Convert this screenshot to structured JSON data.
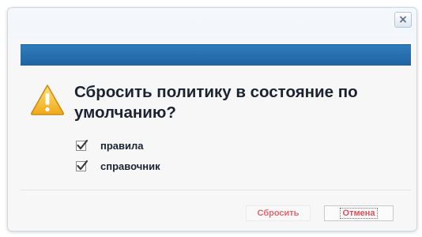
{
  "dialog": {
    "close_label": "×",
    "question": "Сбросить политику в состояние по умолчанию?",
    "warning_icon": "warning-triangle-icon",
    "options": [
      {
        "label": "правила",
        "checked": true
      },
      {
        "label": "справочник",
        "checked": true
      }
    ],
    "buttons": {
      "reset_label": "Сбросить",
      "cancel_label": "Отмена"
    },
    "colors": {
      "titlebar": "#1f64a3",
      "warning": "#f3b92a",
      "button_text": "#d8505c"
    }
  }
}
